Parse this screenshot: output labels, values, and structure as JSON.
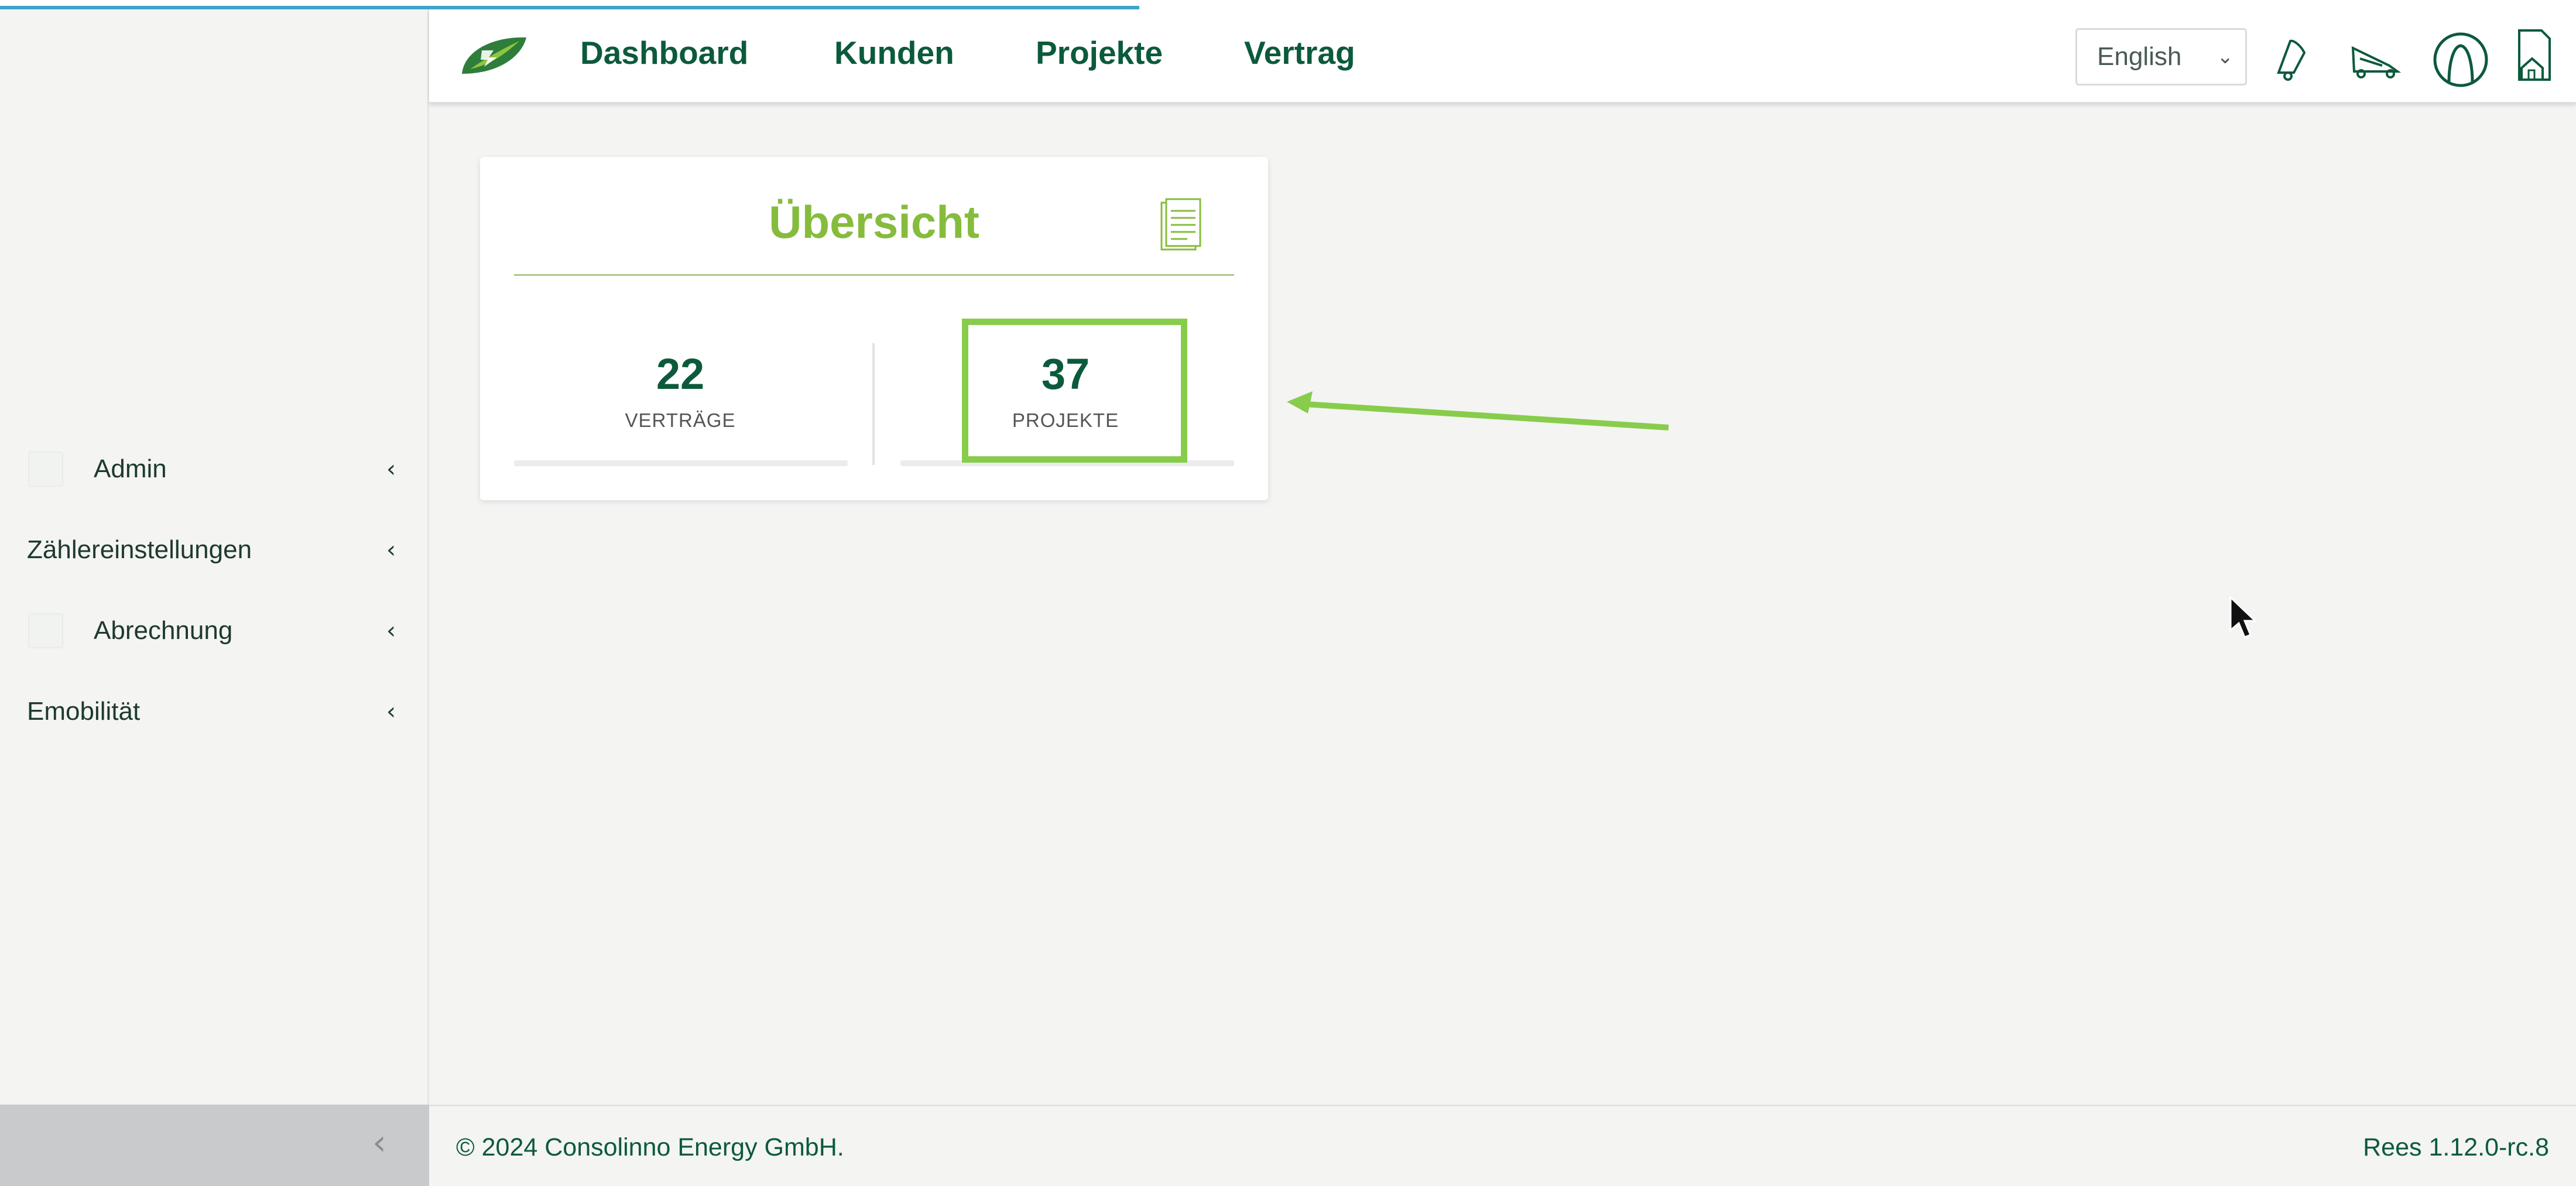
{
  "app": {
    "brand_colors": {
      "primary": "#0c5a3c",
      "accent": "#86bc3d",
      "highlight": "#88cc4c",
      "loading": "#3fa3c9"
    },
    "loading_progress_percent": 44
  },
  "header": {
    "nav": [
      {
        "label": "Dashboard"
      },
      {
        "label": "Kunden"
      },
      {
        "label": "Projekte"
      },
      {
        "label": "Vertrag"
      }
    ],
    "language": {
      "selected": "English"
    },
    "icons": [
      "leaf-logo-icon",
      "bell-icon",
      "shovel-icon",
      "user-avatar-icon",
      "house-document-icon"
    ]
  },
  "sidebar": {
    "items": [
      {
        "label": "Admin",
        "has_icon": true
      },
      {
        "label": "Zählereinstellungen",
        "has_icon": false
      },
      {
        "label": "Abrechnung",
        "has_icon": true
      },
      {
        "label": "Emobilität",
        "has_icon": false
      }
    ],
    "chevron": "‹",
    "collapse_icon": "‹"
  },
  "overview_card": {
    "title": "Übersicht",
    "icon": "document-stack-icon",
    "stats": [
      {
        "value": "22",
        "label": "VERTRÄGE"
      },
      {
        "value": "37",
        "label": "PROJEKTE"
      }
    ]
  },
  "footer": {
    "copyright": "© 2024 Consolinno Energy GmbH.",
    "version": "Rees 1.12.0-rc.8"
  }
}
